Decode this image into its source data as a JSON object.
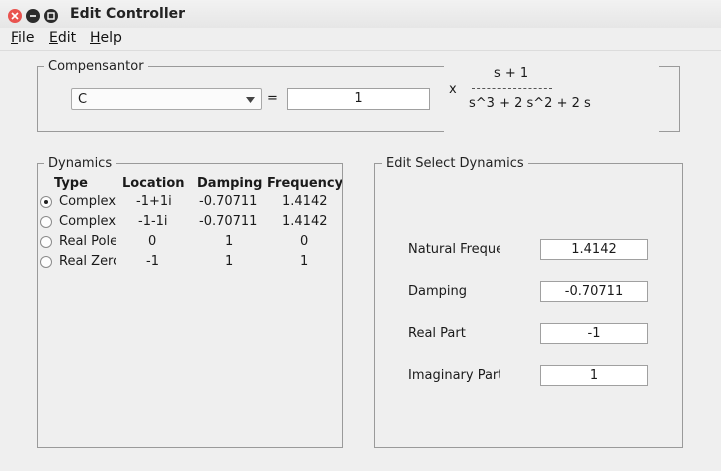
{
  "window": {
    "title": "Edit Controller"
  },
  "menu": [
    {
      "mnemonic": "F",
      "rest": "ile"
    },
    {
      "mnemonic": "E",
      "rest": "dit"
    },
    {
      "mnemonic": "H",
      "rest": "elp"
    }
  ],
  "compensator": {
    "group_title": "Compensantor",
    "selected": "C",
    "equals": "=",
    "gain": "1",
    "times": "x",
    "numerator": "s + 1",
    "denominator": "s^3 + 2 s^2 + 2 s"
  },
  "dynamics": {
    "group_title": "Dynamics",
    "headers": [
      "Type",
      "Location",
      "Damping",
      "Frequency"
    ],
    "rows": [
      {
        "type": "Complex Pole",
        "location": "-1+1i",
        "damping": "-0.70711",
        "frequency": "1.4142",
        "selected": true
      },
      {
        "type": "Complex Pole",
        "location": "-1-1i",
        "damping": "-0.70711",
        "frequency": "1.4142",
        "selected": false
      },
      {
        "type": "Real Pole",
        "location": "0",
        "damping": "1",
        "frequency": "0",
        "selected": false
      },
      {
        "type": "Real Zero",
        "location": "-1",
        "damping": "1",
        "frequency": "1",
        "selected": false
      }
    ]
  },
  "edit": {
    "group_title": "Edit Select Dynamics",
    "fields": [
      {
        "label": "Natural Frequency",
        "value": "1.4142"
      },
      {
        "label": "Damping",
        "value": "-0.70711"
      },
      {
        "label": "Real Part",
        "value": "-1"
      },
      {
        "label": "Imaginary Part",
        "value": "1"
      }
    ]
  }
}
